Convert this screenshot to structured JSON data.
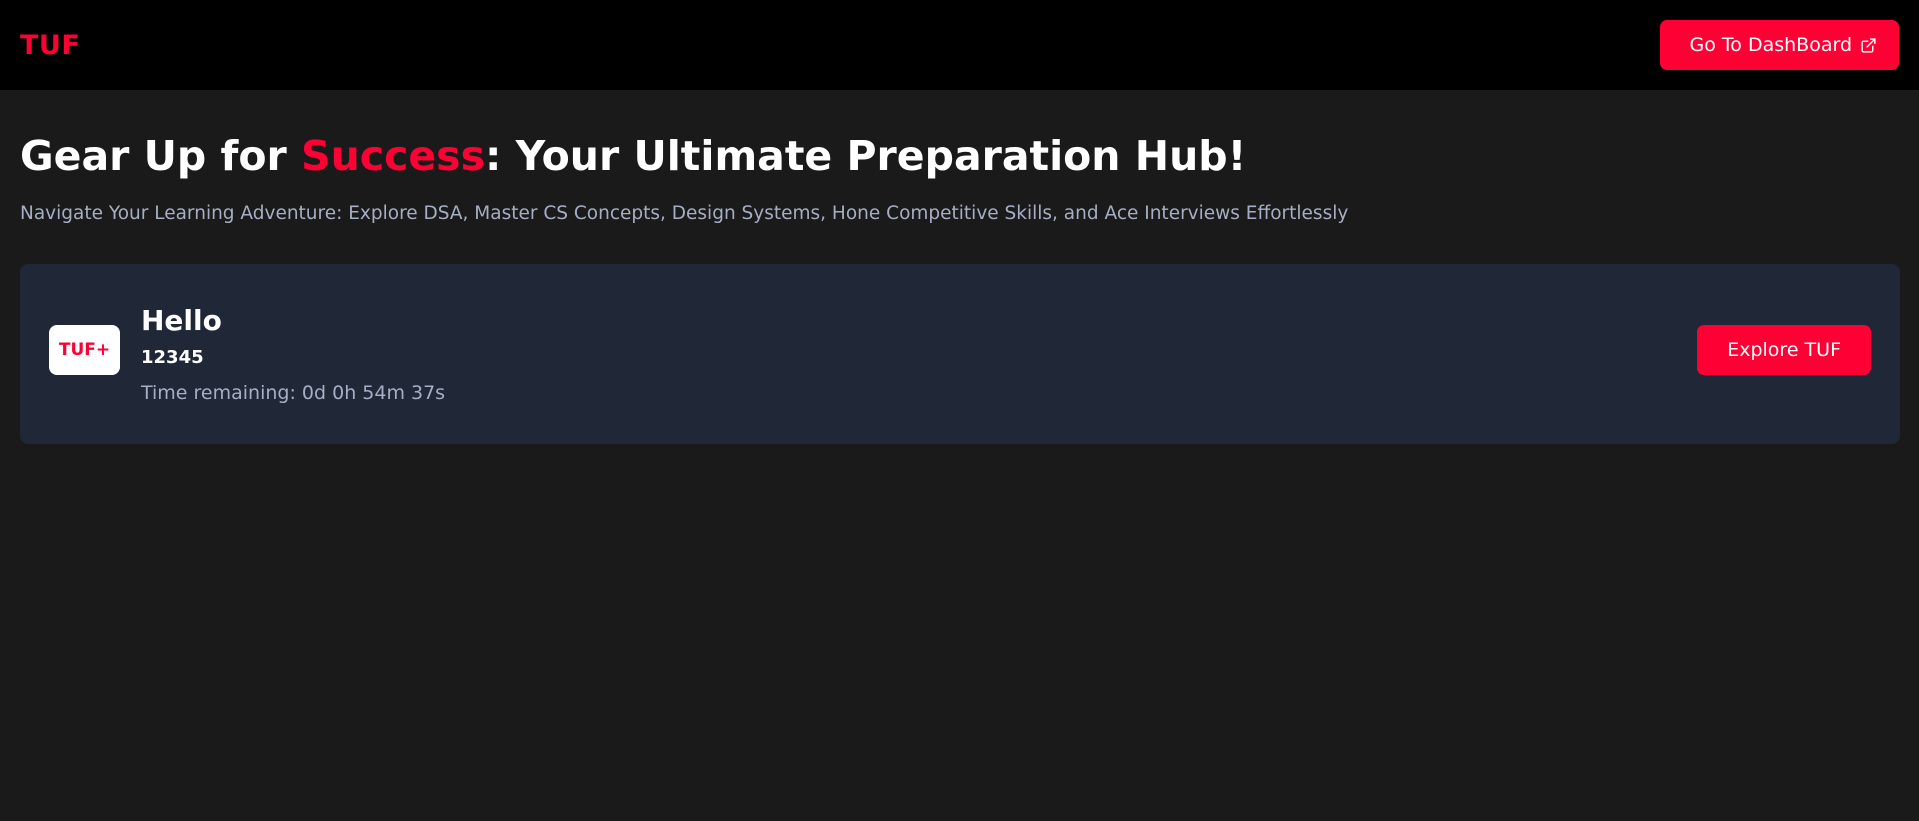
{
  "header": {
    "logo_text": "TUF",
    "dashboard_button_label": "Go To DashBoard",
    "dashboard_button_icon": "external-link-icon"
  },
  "hero": {
    "title_before": "Gear Up for ",
    "title_accent": "Success",
    "title_after": ": Your Ultimate Preparation Hub!",
    "subtitle": "Navigate Your Learning Adventure: Explore DSA, Master CS Concepts, Design Systems, Hone Competitive Skills, and Ace Interviews Effortlessly"
  },
  "card": {
    "badge_text": "TUF+",
    "name": "Hello",
    "id": "12345",
    "timer": "Time remaining: 0d 0h 54m 37s",
    "button_label": "Explore TUF"
  },
  "colors": {
    "accent": "#ff0035",
    "background": "#1a1a1a",
    "header_background": "#000000",
    "card_background": "#202838",
    "muted_text": "#a5aec4"
  }
}
